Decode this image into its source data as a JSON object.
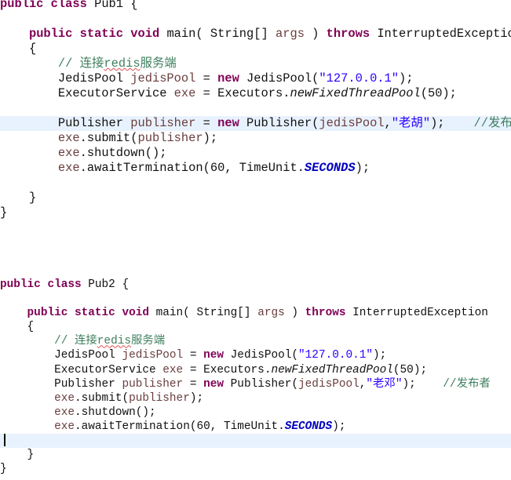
{
  "editor": {
    "colors": {
      "keyword": "#7f0055",
      "string": "#2a00ff",
      "comment": "#3f7f5f",
      "variable": "#6a3e3e",
      "constant": "#0000c0",
      "highlight": "#e8f2fe"
    },
    "blocks": [
      {
        "highlight_line": 8,
        "lines": [
          [
            [
              "public class",
              "kw"
            ],
            [
              " Pub1 {",
              ""
            ]
          ],
          [],
          [
            [
              "    ",
              ""
            ],
            [
              "public static void",
              "kw"
            ],
            [
              " main( String[] ",
              ""
            ],
            [
              "args",
              "var"
            ],
            [
              " ) ",
              ""
            ],
            [
              "throws",
              "kw"
            ],
            [
              " InterruptedException",
              ""
            ]
          ],
          [
            [
              "    {",
              ""
            ]
          ],
          [
            [
              "        ",
              ""
            ],
            [
              "// 连接",
              "cm"
            ],
            [
              "redis",
              "cm sq"
            ],
            [
              "服务端",
              "cm"
            ]
          ],
          [
            [
              "        JedisPool ",
              ""
            ],
            [
              "jedisPool",
              "var"
            ],
            [
              " = ",
              ""
            ],
            [
              "new",
              "kw"
            ],
            [
              " JedisPool(",
              ""
            ],
            [
              "\"127.0.0.1\"",
              "str"
            ],
            [
              ");",
              ""
            ]
          ],
          [
            [
              "        ExecutorService ",
              ""
            ],
            [
              "exe",
              "var"
            ],
            [
              " = Executors.",
              ""
            ],
            [
              "newFixedThreadPool",
              "it"
            ],
            [
              "(50);",
              ""
            ]
          ],
          [],
          [
            [
              "        Publisher ",
              ""
            ],
            [
              "publisher",
              "var"
            ],
            [
              " = ",
              ""
            ],
            [
              "new",
              "kw"
            ],
            [
              " Publisher(",
              ""
            ],
            [
              "jedisPool",
              "var"
            ],
            [
              ",",
              ""
            ],
            [
              "\"老胡\"",
              "str"
            ],
            [
              ");    ",
              ""
            ],
            [
              "//发布者",
              "cm"
            ]
          ],
          [
            [
              "        ",
              ""
            ],
            [
              "exe",
              "var"
            ],
            [
              ".submit(",
              ""
            ],
            [
              "publisher",
              "var"
            ],
            [
              ");",
              ""
            ]
          ],
          [
            [
              "        ",
              ""
            ],
            [
              "exe",
              "var"
            ],
            [
              ".shutdown();",
              ""
            ]
          ],
          [
            [
              "        ",
              ""
            ],
            [
              "exe",
              "var"
            ],
            [
              ".awaitTermination(60, TimeUnit.",
              ""
            ],
            [
              "SECONDS",
              "const"
            ],
            [
              ");",
              ""
            ]
          ],
          [],
          [
            [
              "    }",
              ""
            ]
          ],
          [
            [
              "}",
              ""
            ]
          ]
        ]
      },
      {
        "highlight_line": 11,
        "lines": [
          [
            [
              "public class",
              "kw"
            ],
            [
              " Pub2 {",
              ""
            ]
          ],
          [],
          [
            [
              "    ",
              ""
            ],
            [
              "public static void",
              "kw"
            ],
            [
              " main( String[] ",
              ""
            ],
            [
              "args",
              "var"
            ],
            [
              " ) ",
              ""
            ],
            [
              "throws",
              "kw"
            ],
            [
              " InterruptedException",
              ""
            ]
          ],
          [
            [
              "    {",
              ""
            ]
          ],
          [
            [
              "        ",
              ""
            ],
            [
              "// 连接",
              "cm"
            ],
            [
              "redis",
              "cm sq"
            ],
            [
              "服务端",
              "cm"
            ]
          ],
          [
            [
              "        JedisPool ",
              ""
            ],
            [
              "jedisPool",
              "var"
            ],
            [
              " = ",
              ""
            ],
            [
              "new",
              "kw"
            ],
            [
              " JedisPool(",
              ""
            ],
            [
              "\"127.0.0.1\"",
              "str"
            ],
            [
              ");",
              ""
            ]
          ],
          [
            [
              "        ExecutorService ",
              ""
            ],
            [
              "exe",
              "var"
            ],
            [
              " = Executors.",
              ""
            ],
            [
              "newFixedThreadPool",
              "it"
            ],
            [
              "(50);",
              ""
            ]
          ],
          [
            [
              "        Publisher ",
              ""
            ],
            [
              "publisher",
              "var"
            ],
            [
              " = ",
              ""
            ],
            [
              "new",
              "kw"
            ],
            [
              " Publisher(",
              ""
            ],
            [
              "jedisPool",
              "var"
            ],
            [
              ",",
              ""
            ],
            [
              "\"老邓\"",
              "str"
            ],
            [
              ");    ",
              ""
            ],
            [
              "//发布者",
              "cm"
            ]
          ],
          [
            [
              "        ",
              ""
            ],
            [
              "exe",
              "var"
            ],
            [
              ".submit(",
              ""
            ],
            [
              "publisher",
              "var"
            ],
            [
              ");",
              ""
            ]
          ],
          [
            [
              "        ",
              ""
            ],
            [
              "exe",
              "var"
            ],
            [
              ".shutdown();",
              ""
            ]
          ],
          [
            [
              "        ",
              ""
            ],
            [
              "exe",
              "var"
            ],
            [
              ".awaitTermination(60, TimeUnit.",
              ""
            ],
            [
              "SECONDS",
              "const"
            ],
            [
              ");",
              ""
            ]
          ],
          [],
          [
            [
              "    }",
              ""
            ]
          ],
          [
            [
              "}",
              ""
            ]
          ]
        ]
      }
    ]
  }
}
